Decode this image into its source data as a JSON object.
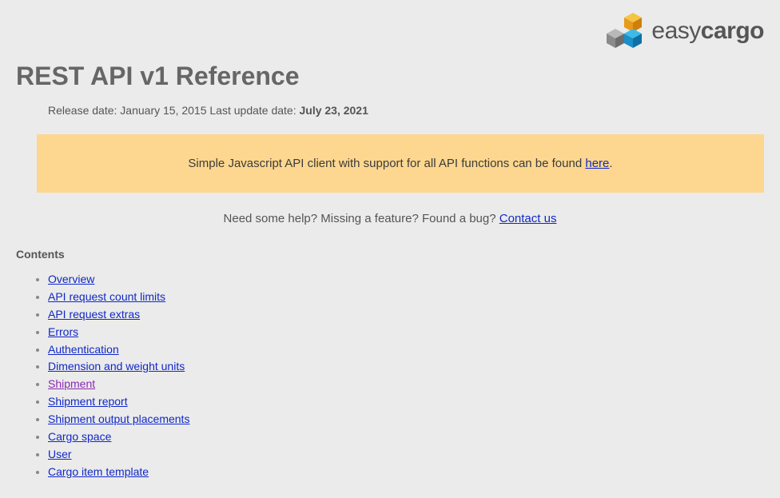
{
  "logo": {
    "easy": "easy",
    "cargo": "cargo"
  },
  "title": "REST API v1 Reference",
  "dates": {
    "release_prefix": "Release date: ",
    "release_date": "January 15, 2015",
    "update_prefix": " Last update date: ",
    "update_date": "July 23, 2021"
  },
  "banner": {
    "text": "Simple Javascript API client with support for all API functions can be found ",
    "link": "here",
    "suffix": "."
  },
  "help": {
    "text": "Need some help? Missing a feature? Found a bug? ",
    "link": "Contact us"
  },
  "contents_heading": "Contents",
  "toc": [
    {
      "label": "Overview",
      "visited": false
    },
    {
      "label": "API request count limits",
      "visited": false
    },
    {
      "label": "API request extras",
      "visited": false
    },
    {
      "label": "Errors",
      "visited": false
    },
    {
      "label": "Authentication",
      "visited": false
    },
    {
      "label": "Dimension and weight units",
      "visited": false
    },
    {
      "label": "Shipment",
      "visited": true
    },
    {
      "label": "Shipment report",
      "visited": false
    },
    {
      "label": "Shipment output placements",
      "visited": false
    },
    {
      "label": "Cargo space",
      "visited": false
    },
    {
      "label": "User",
      "visited": false
    },
    {
      "label": "Cargo item template",
      "visited": false
    }
  ]
}
